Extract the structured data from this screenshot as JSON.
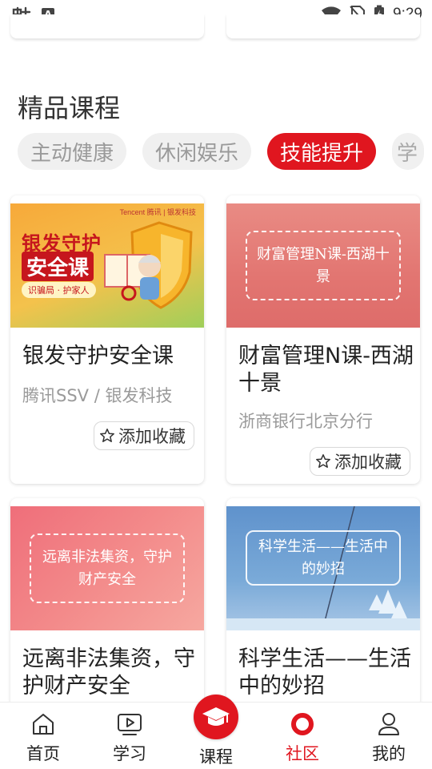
{
  "status_bar": {
    "time": "9:29",
    "icons": [
      "bug-icon",
      "text-a-icon",
      "wifi-icon",
      "no-sim-icon",
      "battery-charging-icon"
    ]
  },
  "section": {
    "title": "精品课程",
    "tabs": [
      {
        "label": "主动健康",
        "active": false
      },
      {
        "label": "休闲娱乐",
        "active": false
      },
      {
        "label": "技能提升",
        "active": true
      },
      {
        "label": "学",
        "active": false
      }
    ]
  },
  "courses": [
    {
      "title": "银发守护安全课",
      "subtitle": "腾讯SSV / 银发科技",
      "fav_label": "添加收藏",
      "thumb": {
        "header_brand": "Tencent 腾讯 | 银发科技",
        "headline_1": "银发守护",
        "headline_2": "安全课",
        "tagline": "识骗局 · 护家人"
      }
    },
    {
      "title": "财富管理N课-西湖十景",
      "subtitle": "浙商银行北京分行",
      "fav_label": "添加收藏",
      "thumb": {
        "text": "财富管理N课-西湖十景"
      }
    },
    {
      "title": "远离非法集资，守护财产安全",
      "thumb": {
        "text": "远离非法集资，守护财产安全"
      }
    },
    {
      "title": "科学生活——生活中的妙招",
      "thumb": {
        "text": "科学生活——生活中的妙招"
      }
    }
  ],
  "bottom_nav": {
    "items": [
      {
        "label": "首页",
        "icon": "home-icon"
      },
      {
        "label": "学习",
        "icon": "video-play-icon"
      },
      {
        "label": "课程",
        "icon": "graduation-cap-icon"
      },
      {
        "label": "社区",
        "icon": "community-ring-icon",
        "active": true
      },
      {
        "label": "我的",
        "icon": "person-icon"
      }
    ]
  },
  "colors": {
    "accent": "#e0161f",
    "chip_bg": "#f0f0f0",
    "chip_text": "#9a9a9a",
    "salmon_thumb": "#e57a78",
    "blue_thumb": "#6a9bd1"
  }
}
